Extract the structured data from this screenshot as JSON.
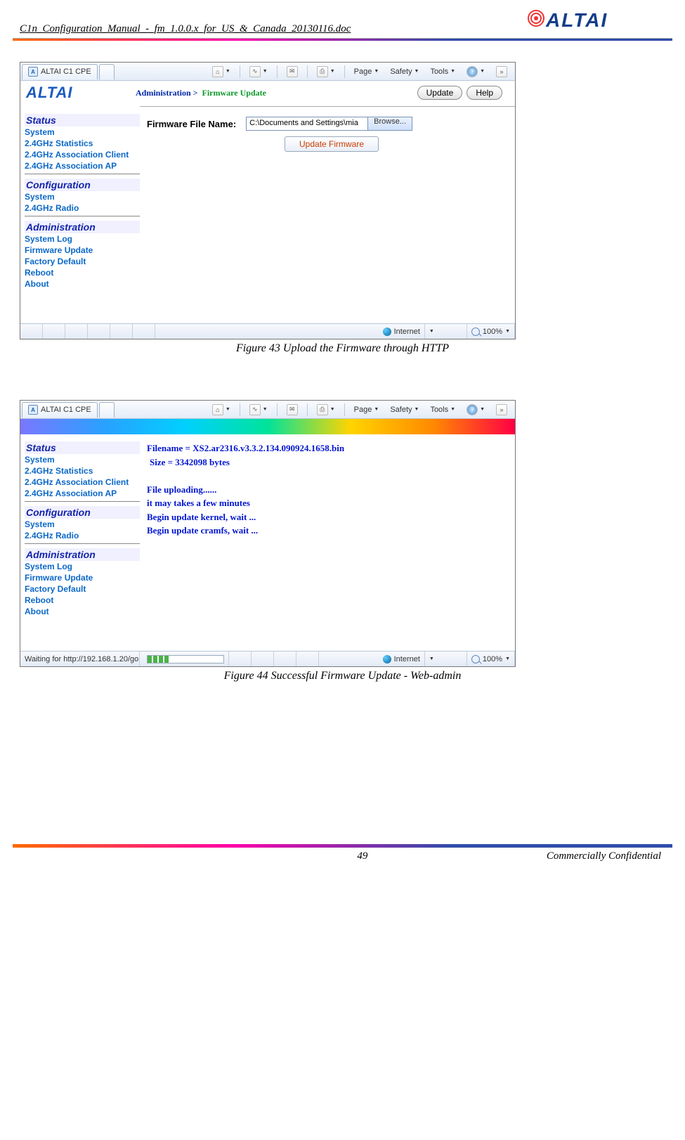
{
  "doc_title": "C1n_Configuration_Manual_-_fm_1.0.0.x_for_US_&_Canada_20130116.doc",
  "top_logo_text": "ALTAI",
  "browser": {
    "tab_title": "ALTAI C1 CPE",
    "tb_page": "Page",
    "tb_safety": "Safety",
    "tb_tools": "Tools",
    "status_internet": "Internet",
    "status_zoom": "100%",
    "status_waiting": "Waiting for http://192.168.1.20/go"
  },
  "sidebar": {
    "h_status": "Status",
    "s_system": "System",
    "s_stats": "2.4GHz Statistics",
    "s_assoc_client": "2.4GHz Association Client",
    "s_assoc_ap": "2.4GHz Association AP",
    "h_config": "Configuration",
    "c_system": "System",
    "c_radio": "2.4GHz Radio",
    "h_admin": "Administration",
    "a_syslog": "System Log",
    "a_fw": "Firmware Update",
    "a_factory": "Factory Default",
    "a_reboot": "Reboot",
    "a_about": "About"
  },
  "fig43": {
    "bc_root": "Administration >",
    "bc_leaf": "Firmware Update",
    "btn_update": "Update",
    "btn_help": "Help",
    "label_file": "Firmware File Name:",
    "file_value": "C:\\Documents and Settings\\mia",
    "btn_browse": "Browse...",
    "btn_update_fw": "Update Firmware",
    "caption": "Figure 43    Upload the Firmware through HTTP"
  },
  "fig44": {
    "line1": "Filename = XS2.ar2316.v3.3.2.134.090924.1658.bin",
    "line2": "Size = 3342098 bytes",
    "line3": "File uploading......",
    "line4": "it may takes a few minutes",
    "line5": "Begin update kernel, wait ...",
    "line6": "Begin update cramfs, wait ...",
    "caption": "Figure 44    Successful Firmware Update - Web-admin"
  },
  "footer": {
    "page_num": "49",
    "confidential": "Commercially Confidential"
  }
}
